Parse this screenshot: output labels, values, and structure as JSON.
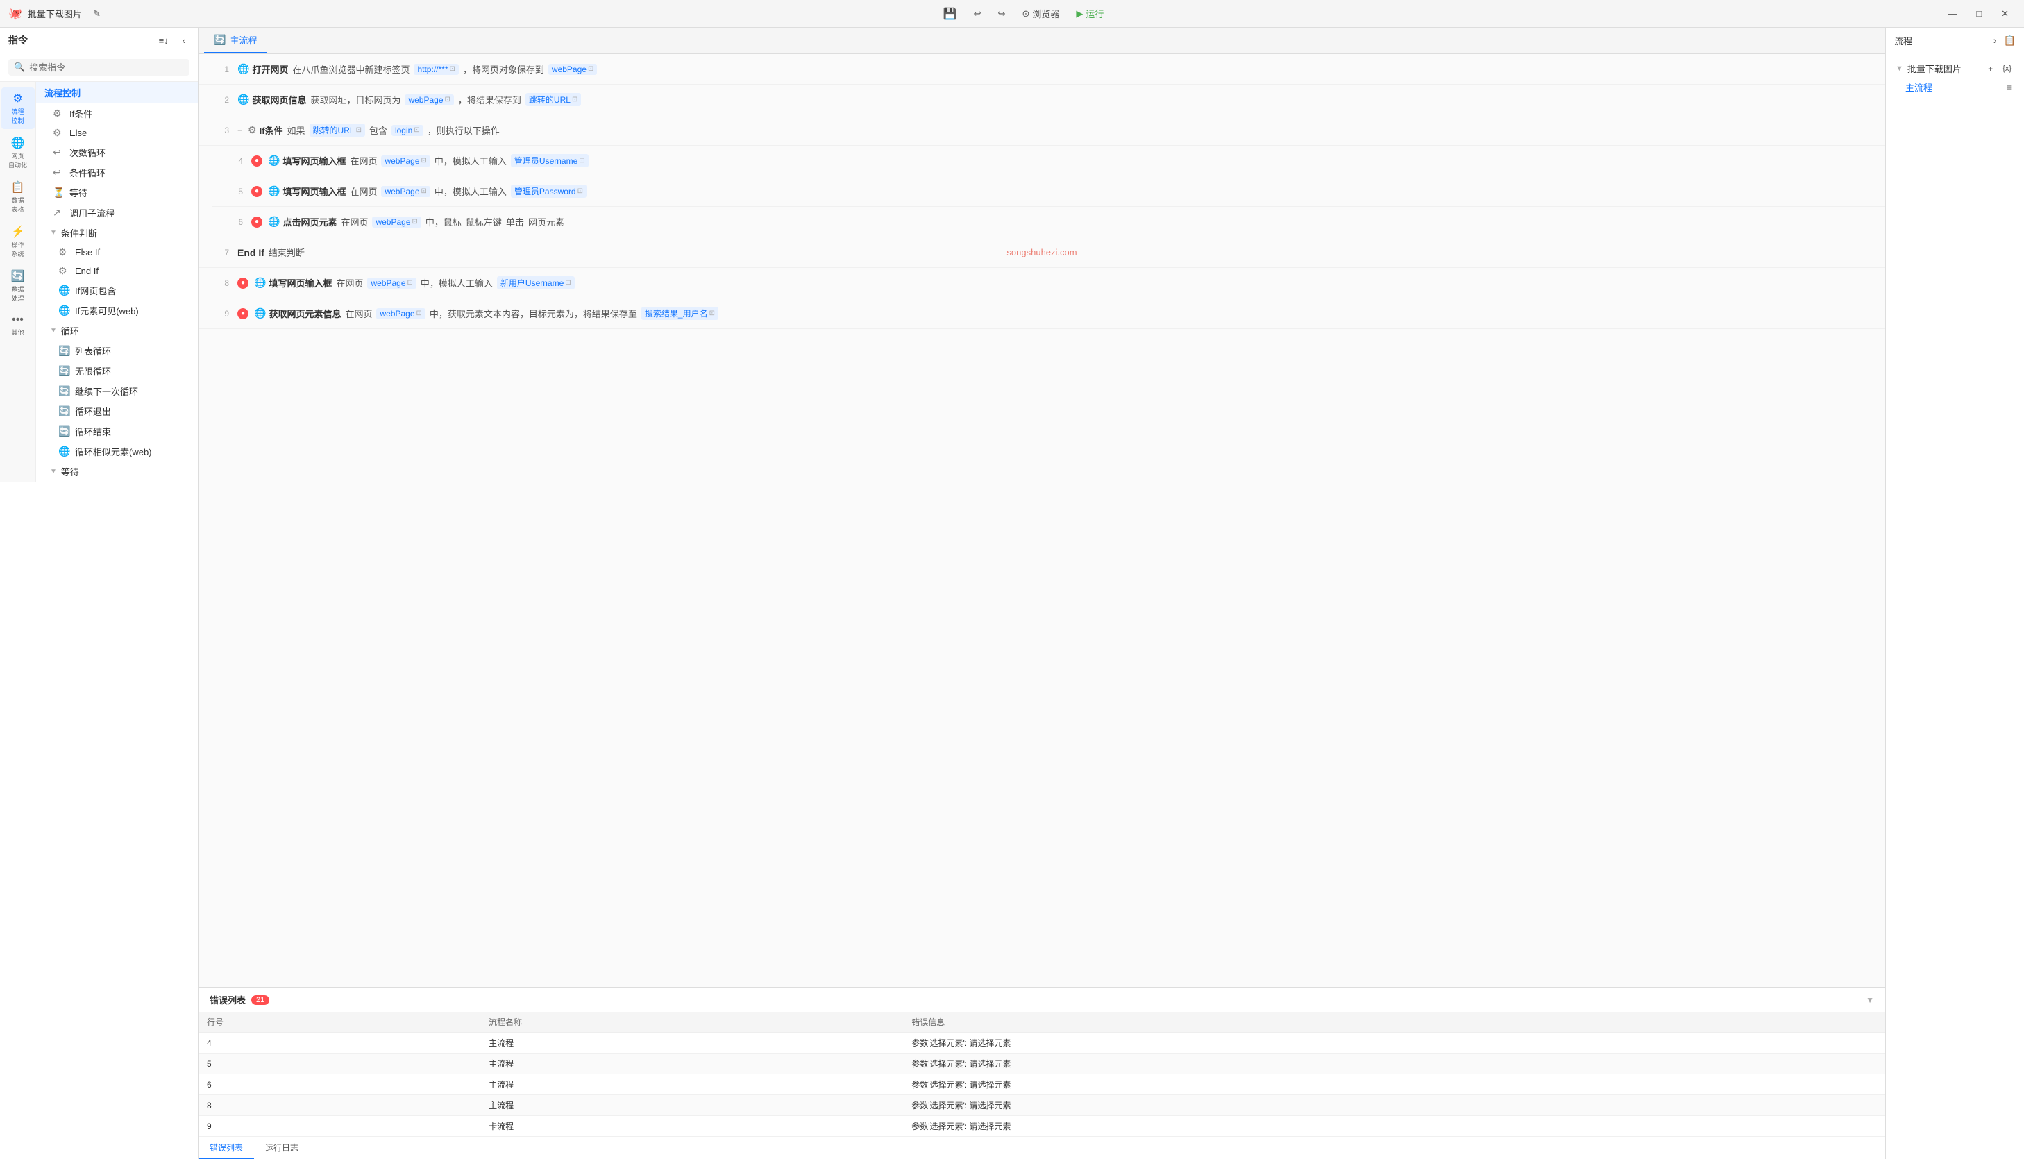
{
  "titleBar": {
    "appName": "批量下载图片",
    "editIcon": "✎",
    "saveIcon": "💾",
    "undoIcon": "↩",
    "redoIcon": "↪",
    "browserLabel": "浏览器",
    "runLabel": "运行",
    "minLabel": "—",
    "maxLabel": "□",
    "closeLabel": "✕"
  },
  "sidebar": {
    "title": "指令",
    "searchPlaceholder": "搜索指令",
    "navItems": [
      {
        "id": "flow-control",
        "icon": "⚙",
        "label": "流程\n控制",
        "active": true
      },
      {
        "id": "web-automation",
        "icon": "🌐",
        "label": "网页\n自动化"
      },
      {
        "id": "data-table",
        "icon": "📋",
        "label": "数据\n表格"
      },
      {
        "id": "operation-system",
        "icon": "⚡",
        "label": "操作\n系统"
      },
      {
        "id": "data-processing",
        "icon": "🔄",
        "label": "数据\n处理"
      },
      {
        "id": "other",
        "icon": "•••",
        "label": "其他"
      }
    ],
    "flowControlSection": {
      "title": "流程控制",
      "items": [
        {
          "id": "if-condition",
          "icon": "⚙",
          "label": "If条件"
        },
        {
          "id": "else",
          "icon": "⚙",
          "label": "Else"
        },
        {
          "id": "count-loop",
          "icon": "↩",
          "label": "次数循环"
        },
        {
          "id": "condition-loop",
          "icon": "↩",
          "label": "条件循环"
        },
        {
          "id": "wait",
          "icon": "⏳",
          "label": "等待"
        },
        {
          "id": "call-subflow",
          "icon": "↗",
          "label": "调用子流程"
        },
        {
          "id": "condition-judge",
          "icon": "▼",
          "label": "条件判断",
          "expanded": true
        },
        {
          "id": "else-if",
          "icon": "⚙",
          "label": "Else If",
          "indent": true
        },
        {
          "id": "end-if",
          "icon": "⚙",
          "label": "End If",
          "indent": true
        },
        {
          "id": "if-page-contain",
          "icon": "🌐",
          "label": "If网页包含",
          "indent": true
        },
        {
          "id": "if-element-visible",
          "icon": "🌐",
          "label": "If元素可见(web)",
          "indent": true
        },
        {
          "id": "loop",
          "icon": "▼",
          "label": "循环",
          "expanded": true
        },
        {
          "id": "list-loop",
          "icon": "🔄",
          "label": "列表循环",
          "indent": true
        },
        {
          "id": "infinite-loop",
          "icon": "🔄",
          "label": "无限循环",
          "indent": true
        },
        {
          "id": "continue-loop",
          "icon": "🔄",
          "label": "继续下一次循环",
          "indent": true
        },
        {
          "id": "loop-exit",
          "icon": "🔄",
          "label": "循环退出",
          "indent": true
        },
        {
          "id": "loop-end",
          "icon": "🔄",
          "label": "循环结束",
          "indent": true
        },
        {
          "id": "loop-similar-element",
          "icon": "🌐",
          "label": "循环相似元素(web)",
          "indent": true
        },
        {
          "id": "wait-section",
          "icon": "▼",
          "label": "等待",
          "sectionHeader": true
        }
      ]
    }
  },
  "flowTabs": [
    {
      "id": "main-flow",
      "label": "主流程",
      "active": true
    }
  ],
  "steps": [
    {
      "num": 1,
      "icon": "🌐",
      "name": "打开网页",
      "parts": [
        "在八爪鱼浏览器中新建标签页",
        "http://***",
        "，将网页对象保存到",
        "webPage"
      ],
      "hasError": false,
      "indent": 0
    },
    {
      "num": 2,
      "icon": "🌐",
      "name": "获取网页信息",
      "parts": [
        "获取网址，目标网页为",
        "webPage",
        "，将结果保存到",
        "跳转的URL"
      ],
      "hasError": false,
      "indent": 0
    },
    {
      "num": 3,
      "icon": "⚙",
      "name": "If条件",
      "parts": [
        "如果",
        "跳转的URL",
        "包含",
        "login",
        "，则执行以下操作"
      ],
      "hasError": false,
      "indent": 0,
      "collapsed": true
    },
    {
      "num": 4,
      "icon": "🌐",
      "name": "填写网页输入框",
      "parts": [
        "在网页",
        "webPage",
        "中，模拟人工输入",
        "管理员Username"
      ],
      "hasError": true,
      "indent": 1
    },
    {
      "num": 5,
      "icon": "🌐",
      "name": "填写网页输入框",
      "parts": [
        "在网页",
        "webPage",
        "中，模拟人工输入",
        "管理员Password"
      ],
      "hasError": true,
      "indent": 1
    },
    {
      "num": 6,
      "icon": "🌐",
      "name": "点击网页元素",
      "parts": [
        "在网页",
        "webPage",
        "中，鼠标",
        "鼠标左键",
        "单击",
        "网页元素"
      ],
      "hasError": true,
      "indent": 1
    },
    {
      "num": 7,
      "name": "End If",
      "parts": [
        "结束判断"
      ],
      "hasError": false,
      "indent": 0,
      "isEndIf": true,
      "watermark": "songshuhezi.com"
    },
    {
      "num": 8,
      "icon": "🌐",
      "name": "填写网页输入框",
      "parts": [
        "在网页",
        "webPage",
        "中，模拟人工输入",
        "新用户Username"
      ],
      "hasError": true,
      "indent": 0
    },
    {
      "num": 9,
      "icon": "🌐",
      "name": "获取网页元素信息",
      "parts": [
        "在网页",
        "webPage",
        "中，获取元素文本内容，目标元素为，将结果保存至",
        "搜索结果_用户名"
      ],
      "hasError": true,
      "indent": 0
    }
  ],
  "errorPanel": {
    "title": "错误列表",
    "count": 21,
    "columns": [
      "行号",
      "流程名称",
      "错误信息"
    ],
    "rows": [
      {
        "line": "4",
        "flow": "主流程",
        "error": "参数'选择元素': 请选择元素"
      },
      {
        "line": "5",
        "flow": "主流程",
        "error": "参数'选择元素': 请选择元素"
      },
      {
        "line": "6",
        "flow": "主流程",
        "error": "参数'选择元素': 请选择元素"
      },
      {
        "line": "8",
        "flow": "主流程",
        "error": "参数'选择元素': 请选择元素"
      },
      {
        "line": "9",
        "flow": "卡流程",
        "error": "参数'选择元素': 请选择元素"
      }
    ],
    "tabs": [
      {
        "id": "error-list",
        "label": "错误列表",
        "active": true
      },
      {
        "id": "run-log",
        "label": "运行日志"
      }
    ]
  },
  "rightPanel": {
    "title": "流程",
    "expandIcon": "›",
    "projectName": "批量下载图片",
    "addIcon": "+",
    "varIcon": "{x}",
    "subFlowLabel": "主流程",
    "layerIcon": "≡"
  }
}
